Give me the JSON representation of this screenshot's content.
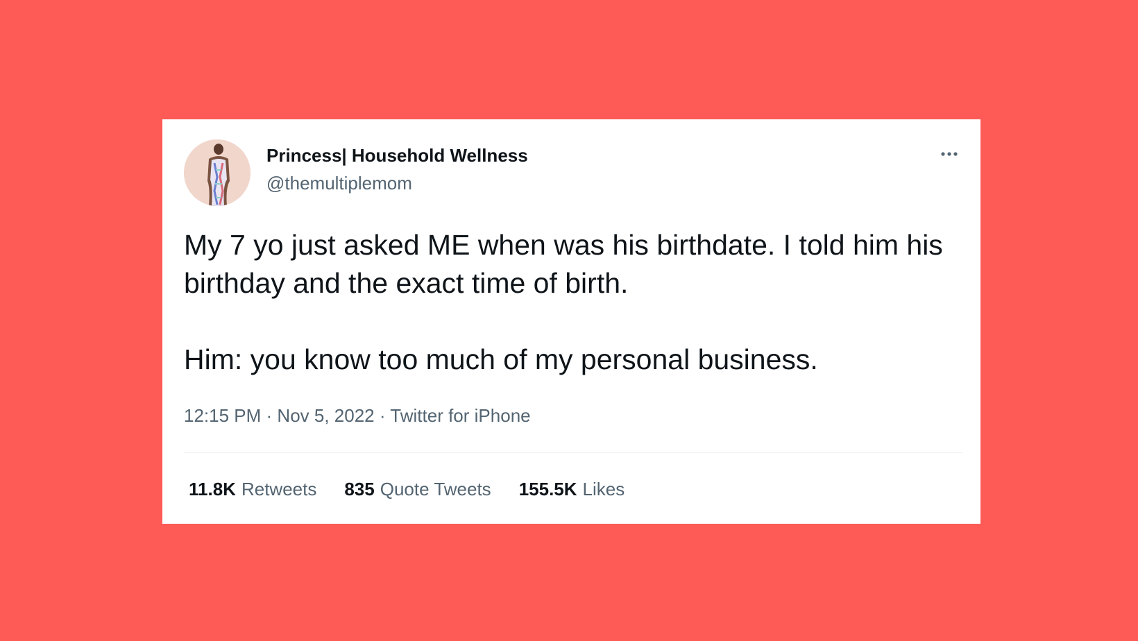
{
  "colors": {
    "background": "#fe5a56",
    "card": "#ffffff",
    "text_primary": "#0f1419",
    "text_secondary": "#536471"
  },
  "tweet": {
    "author_name": "Princess| Household Wellness",
    "handle": "@themultiplemom",
    "more_icon": "more-horizontal-icon",
    "text_paragraph_1": "My 7 yo just asked ME when was his birthdate. I told him his birthday and the exact time of birth.",
    "text_paragraph_2": "Him: you know too much of my personal business.",
    "time": "12:15 PM",
    "date": "Nov 5, 2022",
    "source": "Twitter for iPhone",
    "separator": "·"
  },
  "stats": {
    "retweets_count": "11.8K",
    "retweets_label": "Retweets",
    "quotes_count": "835",
    "quotes_label": "Quote Tweets",
    "likes_count": "155.5K",
    "likes_label": "Likes"
  }
}
